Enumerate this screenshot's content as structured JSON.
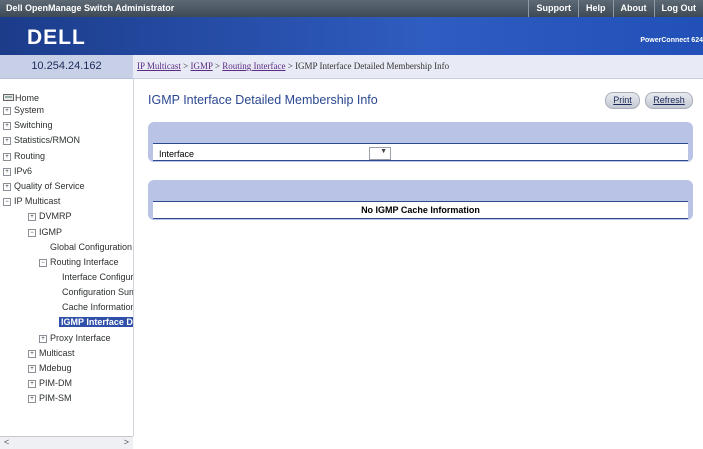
{
  "header": {
    "app_title": "Dell OpenManage Switch Administrator",
    "links": [
      "Support",
      "Help",
      "About",
      "Log Out"
    ],
    "logo": "DELL",
    "product": "PowerConnect 624"
  },
  "ip_address": "10.254.24.162",
  "breadcrumb": {
    "items": [
      "IP Multicast",
      "IGMP",
      "Routing Interface"
    ],
    "separator": ">",
    "current": "IGMP Interface Detailed Membership Info"
  },
  "nav": {
    "items": [
      {
        "label": "Home",
        "icon": "home-icon"
      },
      {
        "label": "System",
        "expander": "+"
      },
      {
        "label": "Switching",
        "expander": "+"
      },
      {
        "label": "Statistics/RMON",
        "expander": "+"
      },
      {
        "label": "Routing",
        "expander": "+"
      },
      {
        "label": "IPv6",
        "expander": "+"
      },
      {
        "label": "Quality of Service",
        "expander": "+"
      },
      {
        "label": "IP Multicast",
        "expander": "−"
      },
      {
        "label": "DVMRP",
        "expander": "+"
      },
      {
        "label": "IGMP",
        "expander": "−"
      },
      {
        "label": "Global Configuration"
      },
      {
        "label": "Routing Interface",
        "expander": "−"
      },
      {
        "label": "Interface Configura"
      },
      {
        "label": "Configuration Sum"
      },
      {
        "label": "Cache Information"
      },
      {
        "label": "IGMP Interface D"
      },
      {
        "label": "Proxy Interface",
        "expander": "+"
      },
      {
        "label": "Multicast",
        "expander": "+"
      },
      {
        "label": "Mdebug",
        "expander": "+"
      },
      {
        "label": "PIM-DM",
        "expander": "+"
      },
      {
        "label": "PIM-SM",
        "expander": "+"
      }
    ]
  },
  "page": {
    "title": "IGMP Interface Detailed Membership Info",
    "print_label": "Print",
    "refresh_label": "Refresh",
    "interface_label": "Interface",
    "interface_value": "",
    "no_cache_message": "No IGMP Cache Information"
  }
}
